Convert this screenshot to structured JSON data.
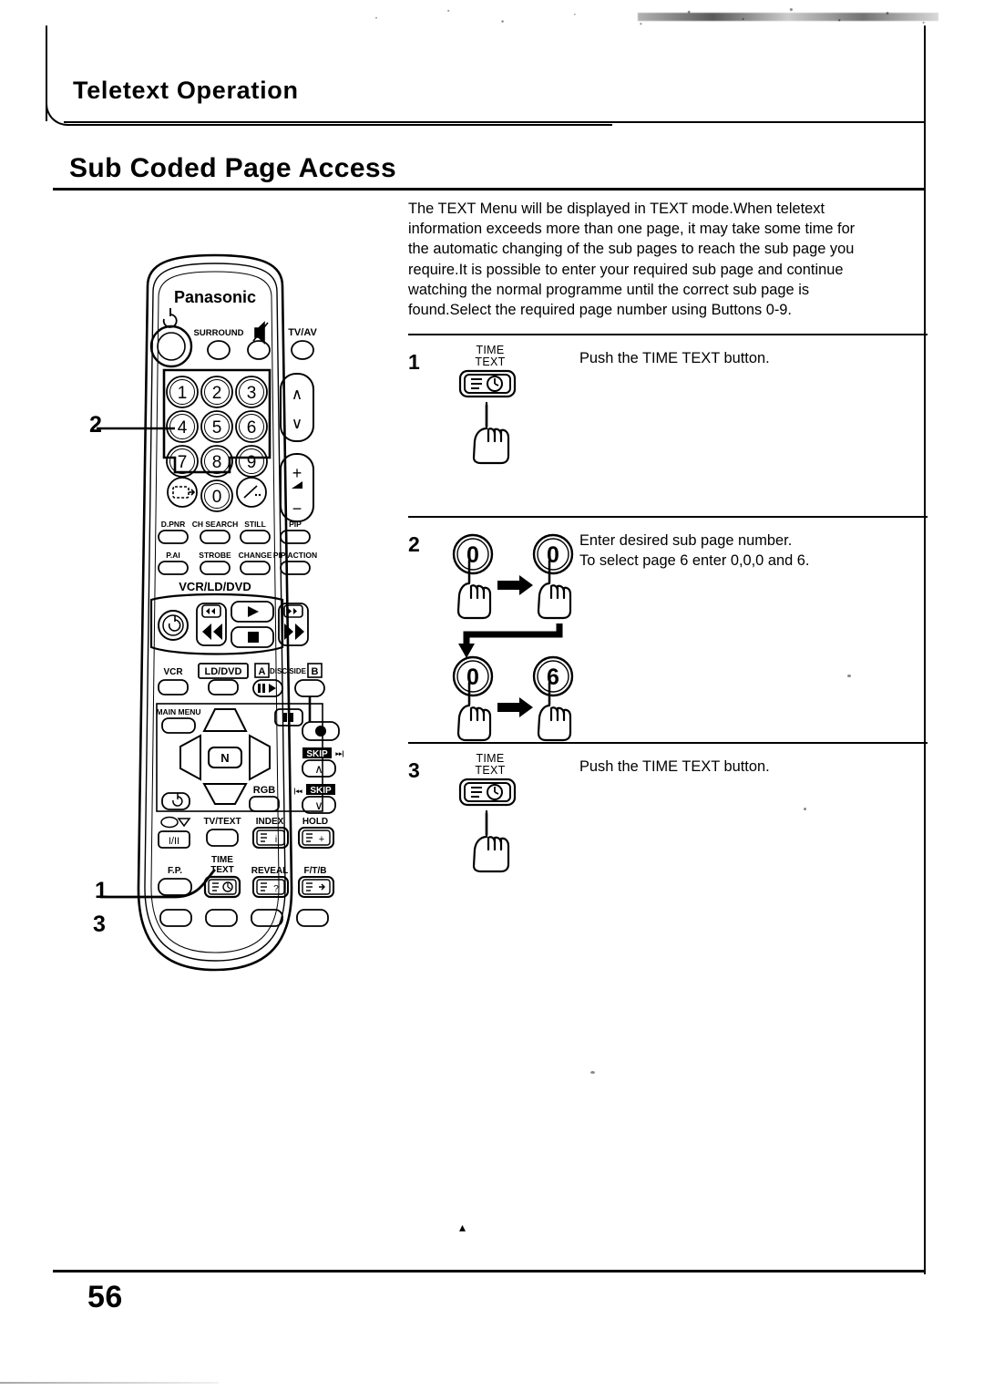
{
  "document": {
    "chapter_title": "Teletext Operation",
    "section_title": "Sub Coded Page Access",
    "page_number": "56",
    "center_mark": "▴"
  },
  "intro": {
    "line1": "The TEXT Menu will be displayed in TEXT mode.When teletext",
    "line2": "information exceeds more than one page, it may take some time for",
    "line3": "the automatic changing of the sub pages to reach the sub page you",
    "line4": "require.It is possible to enter your required sub page and continue",
    "line5": "watching the normal programme until the correct sub page is",
    "line6": "found.Select the required page number using Buttons 0-9."
  },
  "steps": [
    {
      "number": "1",
      "icon_caption_line1": "TIME",
      "icon_caption_line2": "TEXT",
      "icon": "time-text-button-icon",
      "text_line1": "Push the TIME TEXT button.",
      "text_line2": ""
    },
    {
      "number": "2",
      "icon": "number-button-presses",
      "presses": [
        "0",
        "0",
        "0",
        "6"
      ],
      "text_line1": "Enter desired sub page number.",
      "text_line2": "To select page 6 enter 0,0,0 and 6."
    },
    {
      "number": "3",
      "icon_caption_line1": "TIME",
      "icon_caption_line2": "TEXT",
      "icon": "time-text-button-icon",
      "text_line1": "Push the TIME TEXT button.",
      "text_line2": ""
    }
  ],
  "callouts": [
    {
      "label": "2",
      "target": "numeric-keypad"
    },
    {
      "label": "1",
      "target": "time-text-button"
    },
    {
      "label": "3",
      "target": "time-text-button"
    }
  ],
  "remote": {
    "brand": "Panasonic",
    "power_icon": "power-icon",
    "top_row": [
      {
        "label": "SURROUND",
        "name": "surround-button"
      },
      {
        "label": "",
        "icon": "mute-icon",
        "name": "mute-button"
      },
      {
        "label": "TV/AV",
        "name": "tv-av-button"
      }
    ],
    "keypad": [
      "1",
      "2",
      "3",
      "4",
      "5",
      "6",
      "7",
      "8",
      "9"
    ],
    "keypad_bottom": [
      {
        "label": "",
        "icon": "picture-swap-icon",
        "name": "picture-swap-button"
      },
      {
        "label": "0",
        "name": "key-0"
      },
      {
        "label": "",
        "icon": "dash-icon",
        "name": "dash-button"
      }
    ],
    "channel_rocker": {
      "up": "∧",
      "down": "∨"
    },
    "volume_rocker": {
      "up": "+",
      "mid": "◢",
      "down": "−"
    },
    "function_row1": [
      "D.PNR",
      "CH SEARCH",
      "STILL",
      "PIP"
    ],
    "function_row2": [
      "P.AI",
      "STROBE",
      "CHANGE",
      "PIP ACTION"
    ],
    "deck_label": "VCR/LD/DVD",
    "transport": [
      "power-icon",
      "rewind-icon",
      "play-icon",
      "stop-icon",
      "fast-forward-icon"
    ],
    "source_row": [
      {
        "label": "VCR",
        "name": "vcr-button"
      },
      {
        "label": "LD/DVD",
        "name": "ld-dvd-button"
      },
      {
        "label": "A",
        "name": "disc-side-a"
      },
      {
        "label": "DISC SIDE",
        "name": "disc-side-label"
      },
      {
        "label": "B",
        "name": "disc-side-b"
      }
    ],
    "menu_label": "MAIN MENU",
    "nav_center": "N",
    "rgb_label": "RGB",
    "pause_icon": "pause-icon",
    "record_icon": "record-icon",
    "skip_fwd_label": "SKIP",
    "skip_fwd_mark": "▸▸|",
    "skip_back_label": "SKIP",
    "skip_back_mark": "|◂◂",
    "skip_up": "∧",
    "skip_down": "∨",
    "audio_label": "◯▽",
    "audio_button": "I/II",
    "teletext_row1": [
      {
        "label": "TV/TEXT",
        "name": "tv-text-button"
      },
      {
        "label": "INDEX",
        "name": "index-button"
      },
      {
        "label": "HOLD",
        "name": "hold-button"
      }
    ],
    "teletext_row2": [
      {
        "label": "F.P.",
        "name": "fp-button"
      },
      {
        "label_line1": "TIME",
        "label_line2": "TEXT",
        "name": "time-text-button"
      },
      {
        "label": "REVEAL",
        "name": "reveal-button"
      },
      {
        "label": "F/T/B",
        "name": "ftb-button"
      }
    ]
  }
}
